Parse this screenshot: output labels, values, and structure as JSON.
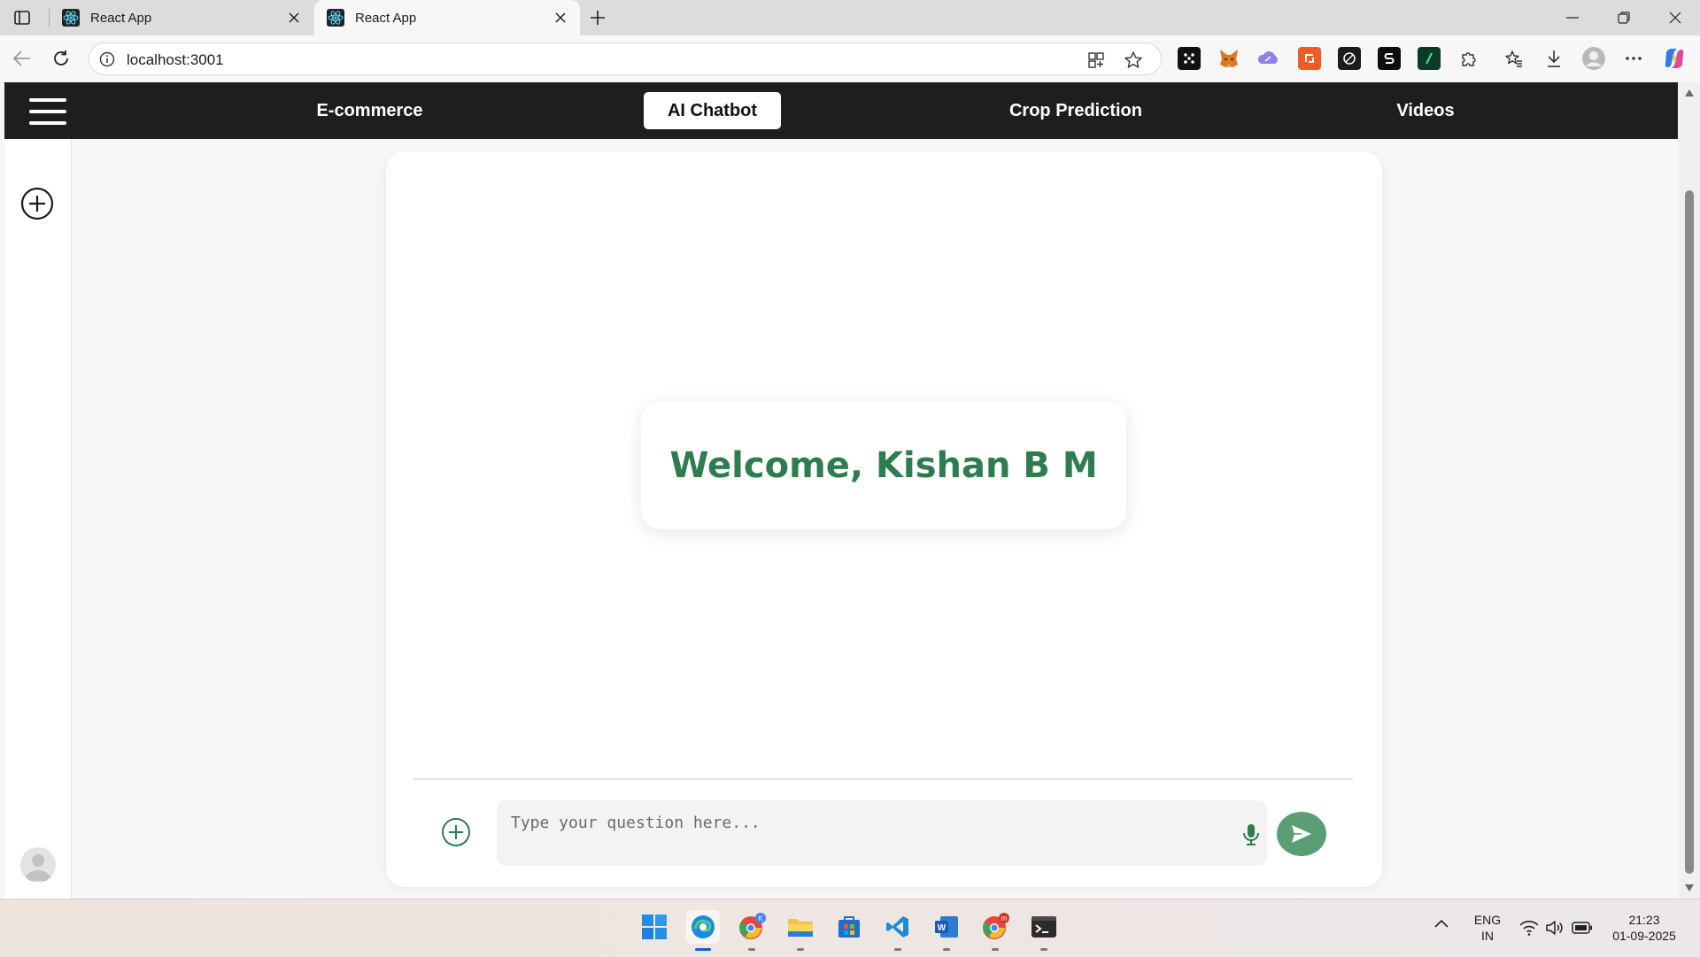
{
  "browser": {
    "tabs": [
      {
        "title": "React App",
        "active": false
      },
      {
        "title": "React App",
        "active": true
      }
    ],
    "address": "localhost:3001"
  },
  "navbar": {
    "links": [
      {
        "label": "E-commerce",
        "active": false
      },
      {
        "label": "AI Chatbot",
        "active": true
      },
      {
        "label": "Crop Prediction",
        "active": false
      },
      {
        "label": "Videos",
        "active": false
      }
    ]
  },
  "chat": {
    "welcome": "Welcome, Kishan B M",
    "input_placeholder": "Type your question here...",
    "input_value": ""
  },
  "taskbar": {
    "language": "ENG",
    "region": "IN",
    "time": "21:23",
    "date": "01-09-2025"
  },
  "colors": {
    "navbar_bg": "#1e1e1e",
    "accent_green": "#2e7d4f",
    "send_button": "#5a9e74"
  }
}
